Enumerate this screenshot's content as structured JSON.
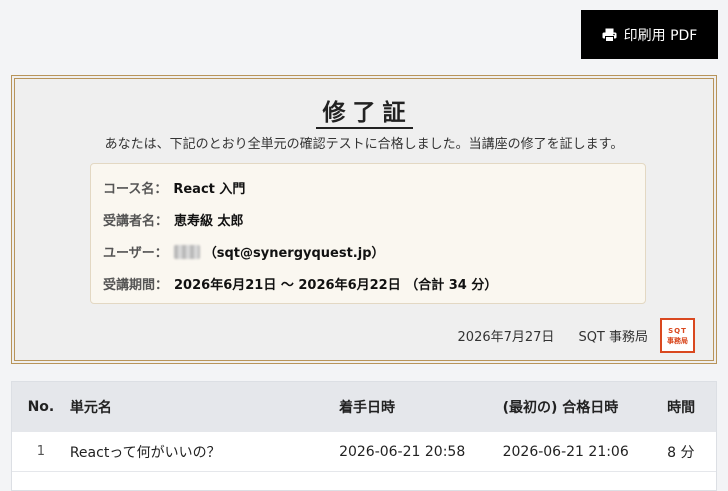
{
  "toolbar": {
    "print_label": "印刷用 PDF",
    "print_icon": "printer-icon"
  },
  "certificate": {
    "title": "修了証",
    "intro": "あなたは、下記のとおり全単元の確認テストに合格しました。当講座の修了を証します。",
    "course_label": "コース名：",
    "course_value": "React 入門",
    "trainee_label": "受講者名：",
    "trainee_value": "恵寿級 太郎",
    "user_label": "ユーザー：",
    "user_email": "（sqt@synergyquest.jp）",
    "period_label": "受講期間：",
    "period_value": "2026年6月21日 〜 2026年6月22日 （合計 34 分）",
    "date": "2026年7月27日",
    "issuer": "SQT 事務局",
    "seal_line1": "SQT",
    "seal_line2": "事務局"
  },
  "table": {
    "headers": {
      "no": "No.",
      "unit": "単元名",
      "start": "着手日時",
      "passed": "(最初の) 合格日時",
      "time": "時間"
    },
    "rows": [
      {
        "no": "1",
        "unit": "Reactって何がいいの？",
        "start": "2026-06-21 20:58",
        "passed": "2026-06-21 21:06",
        "time": "8 分"
      }
    ]
  },
  "colors": {
    "border_gold": "#b8945a",
    "seal_red": "#d9481f",
    "button_bg": "#000000"
  }
}
